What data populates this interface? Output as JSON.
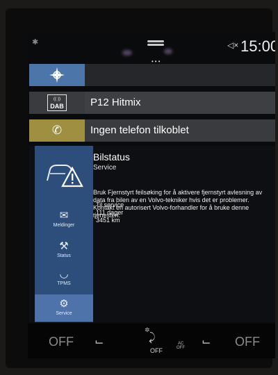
{
  "status_bar": {
    "clock": "15:00",
    "bluetooth_icon": "bluetooth-icon",
    "mute_icon": "speaker-mute-icon",
    "page_dots": "•••"
  },
  "tiles": {
    "navigation": {
      "icon": "compass-icon"
    },
    "radio": {
      "icon": "dab-radio-icon",
      "dab_label": "DAB",
      "title": "P12 Hitmix"
    },
    "phone": {
      "icon": "phone-icon",
      "title": "Ingen telefon tilkoblet"
    }
  },
  "car_status": {
    "title": "Bilstatus",
    "subtitle": "Service",
    "message": "Bruk Fjernstyrt feilsøking for å aktivere fjernstyrt avlesning av data fra bilen av en Volvo-tekniker hvis det er problemer. Kontakt en autorisert Volvo-forhandler for å bruke denne tjenesten.",
    "service": {
      "label": "Til service",
      "days": "111 dager",
      "km": "3451 km"
    },
    "side_items": [
      {
        "label": "Meldinger",
        "icon": "message-icon"
      },
      {
        "label": "Status",
        "icon": "wrench-icon"
      },
      {
        "label": "TPMS",
        "icon": "tire-pressure-icon"
      },
      {
        "label": "Service",
        "icon": "service-icon",
        "active": true
      }
    ]
  },
  "climate": {
    "left_temp": "OFF",
    "right_temp": "OFF",
    "airflow_state": "OFF",
    "ac_label": "AC",
    "ac_state": "OFF"
  },
  "colors": {
    "nav_accent": "#4c75aa",
    "phone_accent": "#9e9040",
    "status_side": "#2d4d7a",
    "status_active": "#4d73aa"
  }
}
